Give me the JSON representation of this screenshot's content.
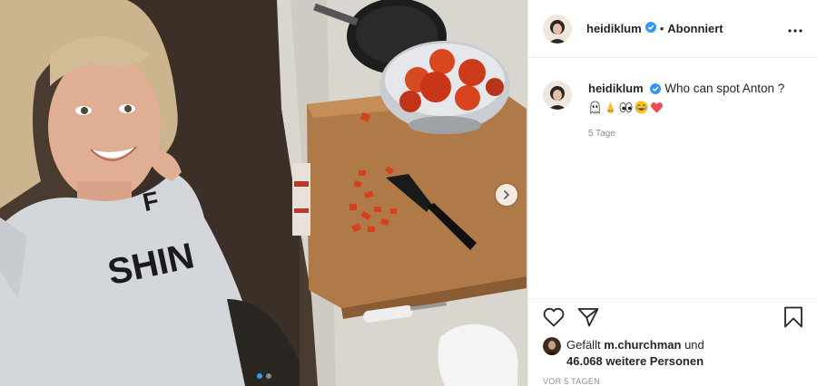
{
  "post": {
    "username": "heidiklum",
    "separator": "•",
    "follow_status": "Abonniert",
    "caption_username": "heidiklum",
    "caption_text": "Who can spot Anton ?",
    "caption_emojis": [
      "ghost-emoji",
      "nose-emoji",
      "eyes-emoji",
      "laughing-emoji",
      "red-heart-emoji"
    ],
    "posted_relative": "5 Tage",
    "liked_by_prefix": "Gefällt",
    "liked_by_user": "m.churchman",
    "liked_by_joiner": "und",
    "likes_count": "46.068 weitere Personen",
    "posted_ago": "VOR 5 TAGEN"
  },
  "media": {
    "carousel_total": 2,
    "carousel_active": 1,
    "shirt_text": "SHIN"
  },
  "colors": {
    "verified_badge": "#3897f0",
    "accent_dot": "#3897f0",
    "heart": "#ed4956"
  },
  "icons": {
    "verified": "verified-badge-icon",
    "more": "more-options-icon",
    "next": "chevron-right-icon",
    "like": "heart-outline-icon",
    "share": "paper-plane-icon",
    "save": "bookmark-icon"
  }
}
